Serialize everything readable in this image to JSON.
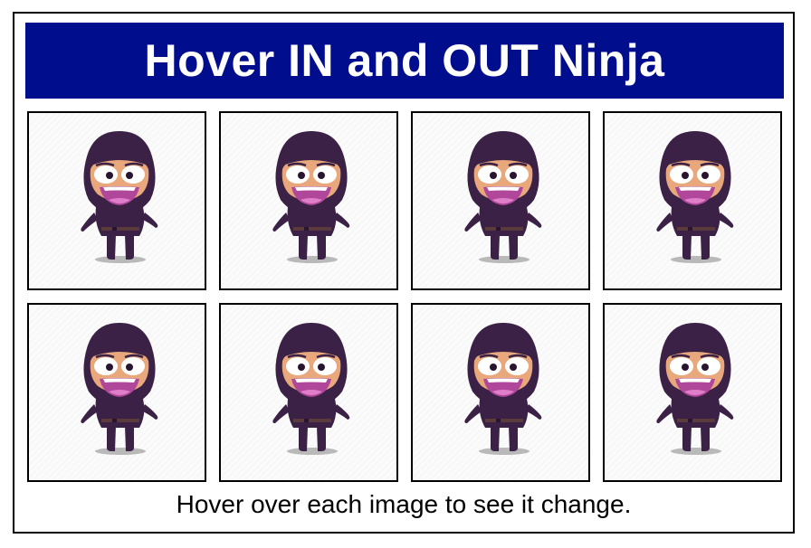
{
  "header": {
    "title": "Hover IN and OUT Ninja"
  },
  "gallery": {
    "tiles": [
      {
        "icon": "ninja-icon"
      },
      {
        "icon": "ninja-icon"
      },
      {
        "icon": "ninja-icon"
      },
      {
        "icon": "ninja-icon"
      },
      {
        "icon": "ninja-icon"
      },
      {
        "icon": "ninja-icon"
      },
      {
        "icon": "ninja-icon"
      },
      {
        "icon": "ninja-icon"
      }
    ]
  },
  "footer": {
    "caption": "Hover over each image to see it change."
  },
  "colors": {
    "banner_background": "#000d8c",
    "banner_text": "#ffffff",
    "ninja_body": "#3a2145",
    "ninja_skin": "#e8a87c",
    "ninja_mouth": "#b0479b"
  }
}
